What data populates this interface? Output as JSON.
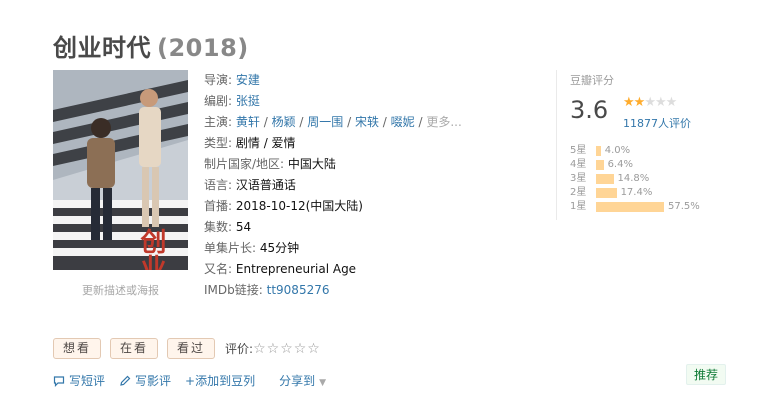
{
  "title": {
    "name": "创业时代",
    "year": "(2018)"
  },
  "poster": {
    "link_text": "更新描述或海报",
    "art_text": "创业时代"
  },
  "info": {
    "director_label": "导演:",
    "director": "安建",
    "writer_label": "编剧:",
    "writer": "张挺",
    "cast_label": "主演:",
    "cast": [
      "黄轩",
      "杨颖",
      "周一围",
      "宋轶",
      "啜妮"
    ],
    "cast_more": "更多...",
    "genre_label": "类型:",
    "genre": "剧情 / 爱情",
    "country_label": "制片国家/地区:",
    "country": "中国大陆",
    "language_label": "语言:",
    "language": "汉语普通话",
    "premiere_label": "首播:",
    "premiere": "2018-10-12(中国大陆)",
    "episodes_label": "集数:",
    "episodes": "54",
    "runtime_label": "单集片长:",
    "runtime": "45分钟",
    "aka_label": "又名:",
    "aka": "Entrepreneurial Age",
    "imdb_label": "IMDb链接:",
    "imdb": "tt9085276"
  },
  "rating": {
    "label": "豆瓣评分",
    "score": "3.6",
    "stars_filled": 2,
    "stars_total": 5,
    "votes": "11877人评价",
    "distribution": [
      {
        "label": "5星",
        "pct": "4.0%",
        "value": 4.0
      },
      {
        "label": "4星",
        "pct": "6.4%",
        "value": 6.4
      },
      {
        "label": "3星",
        "pct": "14.8%",
        "value": 14.8
      },
      {
        "label": "2星",
        "pct": "17.4%",
        "value": 17.4
      },
      {
        "label": "1星",
        "pct": "57.5%",
        "value": 57.5
      }
    ]
  },
  "buttons": {
    "want": "想看",
    "watching": "在看",
    "watched": "看过",
    "my_rating_label": "评价:"
  },
  "actions": {
    "short_review": "写短评",
    "review": "写影评",
    "add_list": "+添加到豆列",
    "share": "分享到"
  },
  "recommend": "推荐",
  "colors": {
    "link": "#3377aa",
    "star": "#ffac2d",
    "bar": "#ffd596",
    "recommend_text": "#0f7b36"
  }
}
